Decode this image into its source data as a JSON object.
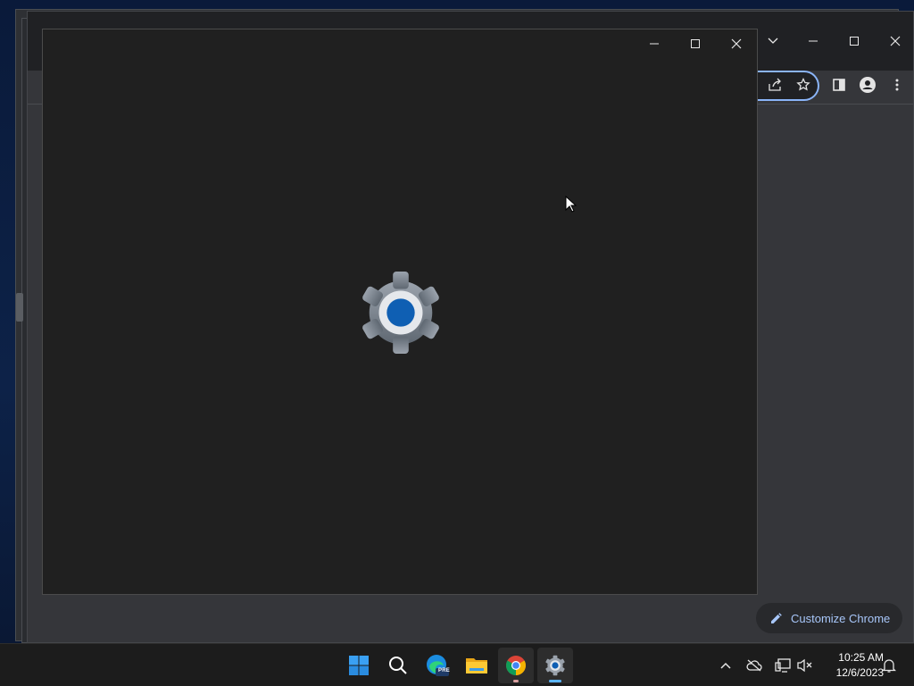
{
  "chrome": {
    "customize_label": "Customize Chrome"
  },
  "taskbar": {
    "items": [
      {
        "name": "Start",
        "icon": "windows-start-icon"
      },
      {
        "name": "Search",
        "icon": "search-icon"
      },
      {
        "name": "Microsoft Edge Preview",
        "icon": "edge-preview-icon",
        "badge": "PRE"
      },
      {
        "name": "File Explorer",
        "icon": "folder-icon"
      },
      {
        "name": "Google Chrome",
        "icon": "chrome-icon"
      },
      {
        "name": "Settings",
        "icon": "gear-icon"
      }
    ],
    "clock": {
      "time": "10:25 AM",
      "date": "12/6/2023"
    }
  },
  "colors": {
    "accent": "#0067c0",
    "chrome_focus": "#8ab4f8",
    "taskbar": "#1c1c1c",
    "settings_bg": "#202020"
  }
}
